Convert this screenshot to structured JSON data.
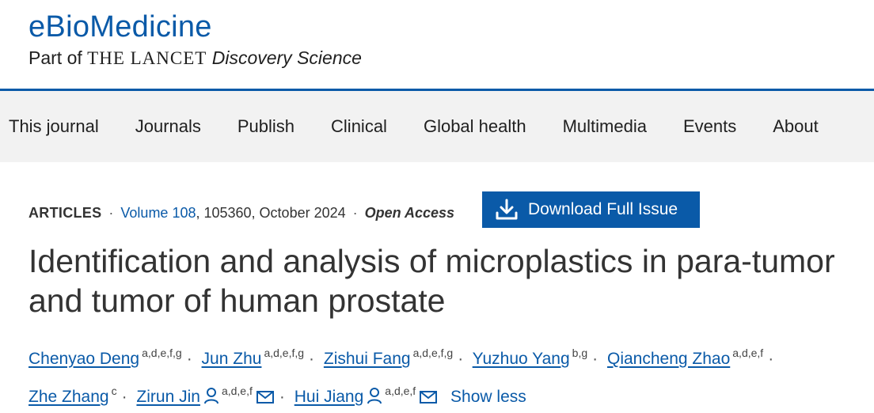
{
  "brand": {
    "title": "eBioMedicine",
    "sub_prefix": "Part of",
    "sub_lancet": "THE LANCET",
    "sub_discovery": "Discovery Science"
  },
  "nav": {
    "items": [
      "This journal",
      "Journals",
      "Publish",
      "Clinical",
      "Global health",
      "Multimedia",
      "Events",
      "About"
    ]
  },
  "article_meta": {
    "type": "ARTICLES",
    "volume": "Volume 108",
    "details": ", 105360, October 2024",
    "access": "Open Access"
  },
  "download_button": {
    "label": "Download Full Issue"
  },
  "article": {
    "title": "Identification and analysis of microplastics in para-tumor and tumor of human prostate"
  },
  "authors": [
    {
      "name": "Chenyao Deng",
      "aff": "a,d,e,f,g"
    },
    {
      "name": "Jun Zhu",
      "aff": "a,d,e,f,g"
    },
    {
      "name": "Zishui Fang",
      "aff": "a,d,e,f,g"
    },
    {
      "name": "Yuzhuo Yang",
      "aff": "b,g"
    },
    {
      "name": "Qiancheng Zhao",
      "aff": "a,d,e,f"
    },
    {
      "name": "Zhe Zhang",
      "aff": "c"
    },
    {
      "name": "Zirun Jin",
      "aff": "a,d,e,f"
    },
    {
      "name": "Hui Jiang",
      "aff": "a,d,e,f"
    }
  ],
  "show_less": "Show less",
  "colors": {
    "accent": "#0a5aa8",
    "nav_bg": "#f2f2f2",
    "text": "#333333"
  }
}
